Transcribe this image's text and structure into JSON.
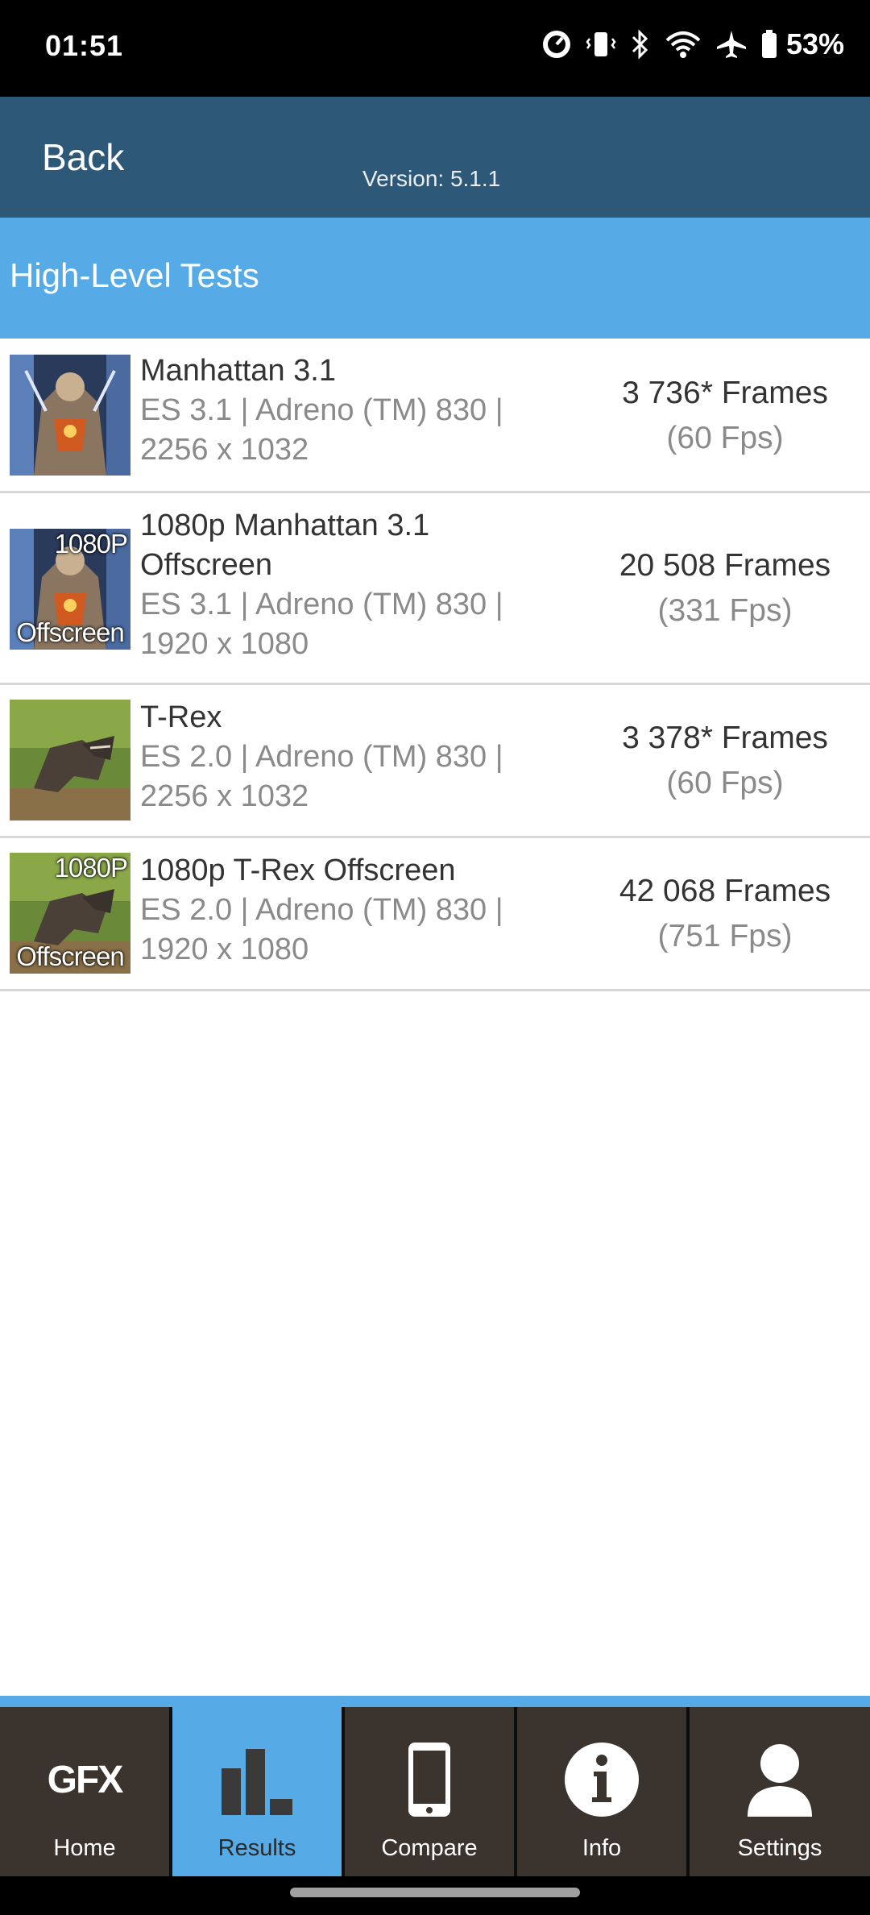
{
  "status_bar": {
    "time": "01:51",
    "battery": "53%",
    "icons": [
      "speedometer-icon",
      "vibrate-icon",
      "bluetooth-icon",
      "wifi-icon",
      "airplane-icon",
      "battery-icon"
    ]
  },
  "header": {
    "back_label": "Back",
    "version": "Version: 5.1.1"
  },
  "section": {
    "title": "High-Level Tests"
  },
  "tests": [
    {
      "name": "Manhattan 3.1",
      "detail": "ES 3.1 | Adreno (TM) 830 | 2256 x 1032",
      "frames": "3 736* Frames",
      "fps": "(60 Fps)",
      "thumb_top": "",
      "thumb_bottom": ""
    },
    {
      "name": "1080p Manhattan 3.1 Offscreen",
      "detail": "ES 3.1 | Adreno (TM) 830 | 1920 x 1080",
      "frames": "20 508 Frames",
      "fps": "(331 Fps)",
      "thumb_top": "1080P",
      "thumb_bottom": "Offscreen"
    },
    {
      "name": "T-Rex",
      "detail": "ES 2.0 | Adreno (TM) 830 | 2256 x 1032",
      "frames": "3 378* Frames",
      "fps": "(60 Fps)",
      "thumb_top": "",
      "thumb_bottom": ""
    },
    {
      "name": "1080p T-Rex Offscreen",
      "detail": "ES 2.0 | Adreno (TM) 830 | 1920 x 1080",
      "frames": "42 068 Frames",
      "fps": "(751 Fps)",
      "thumb_top": "1080P",
      "thumb_bottom": "Offscreen"
    }
  ],
  "nav": {
    "home_logo": "GFX",
    "items": [
      {
        "label": "Home",
        "icon": "gfx-logo-icon"
      },
      {
        "label": "Results",
        "icon": "bar-chart-icon",
        "active": true
      },
      {
        "label": "Compare",
        "icon": "phone-icon"
      },
      {
        "label": "Info",
        "icon": "info-icon"
      },
      {
        "label": "Settings",
        "icon": "user-icon"
      }
    ]
  },
  "colors": {
    "header": "#2e5878",
    "accent": "#56aae6",
    "nav_bg": "#3a332e"
  }
}
